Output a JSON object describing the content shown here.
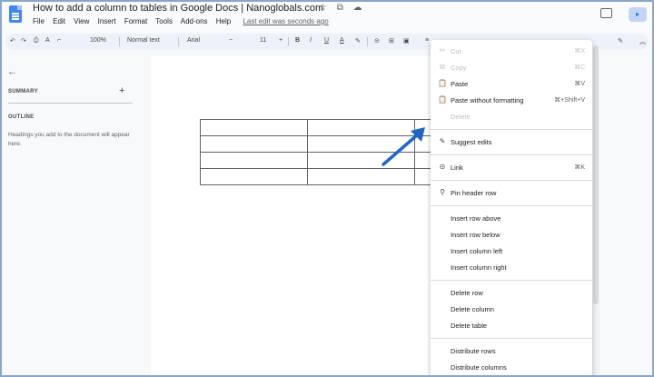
{
  "header": {
    "title": "How to add a column to tables in Google Docs | Nanoglobals.com",
    "title_icons": "☆ ⧉ ☁",
    "menu": [
      "File",
      "Edit",
      "View",
      "Insert",
      "Format",
      "Tools",
      "Add-ons",
      "Help"
    ],
    "last_edit": "Last edit was seconds ago"
  },
  "toolbar": {
    "undo": "↶",
    "redo": "↷",
    "print": "⎙",
    "spell": "A",
    "paint": "⌐",
    "zoom": "100%",
    "style": "Normal text",
    "font": "Arial",
    "font_minus": "−",
    "font_size": "11",
    "font_plus": "+",
    "bold": "B",
    "italic": "I",
    "underline": "U",
    "text_color": "A",
    "highlight": "✎",
    "link": "⊝",
    "comment": "⊞",
    "image": "▣",
    "align": "≡",
    "pen": "✎",
    "collapse": "︽"
  },
  "sidebar": {
    "back": "←",
    "summary_label": "SUMMARY",
    "add": "+",
    "outline_label": "OUTLINE",
    "outline_text": "Headings you add to the document will appear here."
  },
  "table": {
    "rows": 4,
    "columns": 3
  },
  "context_menu": {
    "items": [
      {
        "icon": "✂",
        "label": "Cut",
        "shortcut": "⌘X",
        "disabled": true
      },
      {
        "icon": "⧉",
        "label": "Copy",
        "shortcut": "⌘C",
        "disabled": true
      },
      {
        "icon": "📋",
        "label": "Paste",
        "shortcut": "⌘V",
        "disabled": false
      },
      {
        "icon": "📋",
        "label": "Paste without formatting",
        "shortcut": "⌘+Shift+V",
        "disabled": false
      },
      {
        "icon": "",
        "label": "Delete",
        "shortcut": "",
        "disabled": true
      },
      {
        "icon": "✎",
        "label": "Suggest edits",
        "shortcut": "",
        "disabled": false
      },
      {
        "icon": "⊝",
        "label": "Link",
        "shortcut": "⌘K",
        "disabled": false
      },
      {
        "icon": "⚲",
        "label": "Pin header row",
        "shortcut": "",
        "disabled": false
      },
      {
        "icon": "",
        "label": "Insert row above",
        "shortcut": "",
        "disabled": false
      },
      {
        "icon": "",
        "label": "Insert row below",
        "shortcut": "",
        "disabled": false
      },
      {
        "icon": "",
        "label": "Insert column left",
        "shortcut": "",
        "disabled": false
      },
      {
        "icon": "",
        "label": "Insert column right",
        "shortcut": "",
        "disabled": false
      },
      {
        "icon": "",
        "label": "Delete row",
        "shortcut": "",
        "disabled": false
      },
      {
        "icon": "",
        "label": "Delete column",
        "shortcut": "",
        "disabled": false
      },
      {
        "icon": "",
        "label": "Delete table",
        "shortcut": "",
        "disabled": false
      },
      {
        "icon": "",
        "label": "Distribute rows",
        "shortcut": "",
        "disabled": false
      },
      {
        "icon": "",
        "label": "Distribute columns",
        "shortcut": "",
        "disabled": false
      }
    ]
  },
  "colors": {
    "accent": "#1a73e8",
    "arrow": "#1f66c8",
    "disabled_text": "#bdc1c6"
  }
}
